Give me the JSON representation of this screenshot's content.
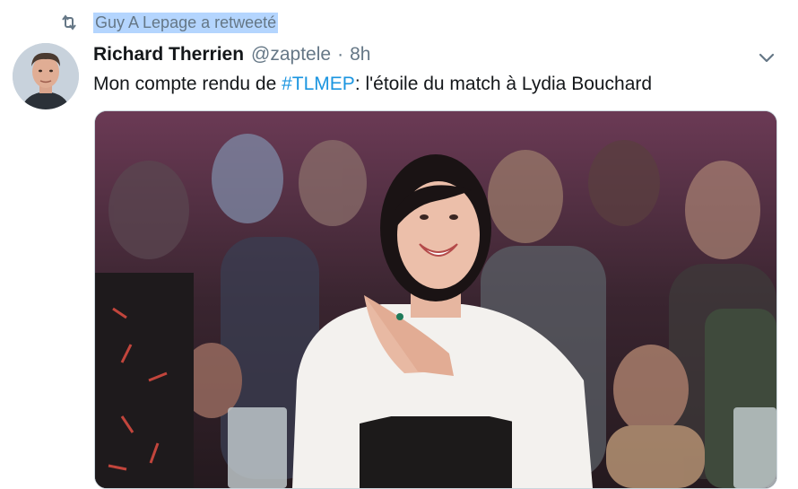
{
  "retweet": {
    "icon": "retweet-icon",
    "label": "Guy A Lepage a retweeté"
  },
  "tweet": {
    "author_name": "Richard Therrien",
    "handle": "@zaptele",
    "separator": "·",
    "time": "8h",
    "text_before": "Mon compte rendu de ",
    "hashtag": "#TLMEP",
    "text_after": ": l'étoile du match à Lydia Bouchard",
    "avatar": "author-avatar",
    "menu_icon": "chevron-down-icon",
    "media": "tv-show-photo"
  },
  "colors": {
    "link": "#1b95e0",
    "secondary": "#657786",
    "selection": "#b4d5fe",
    "border": "#ccd6dd"
  }
}
